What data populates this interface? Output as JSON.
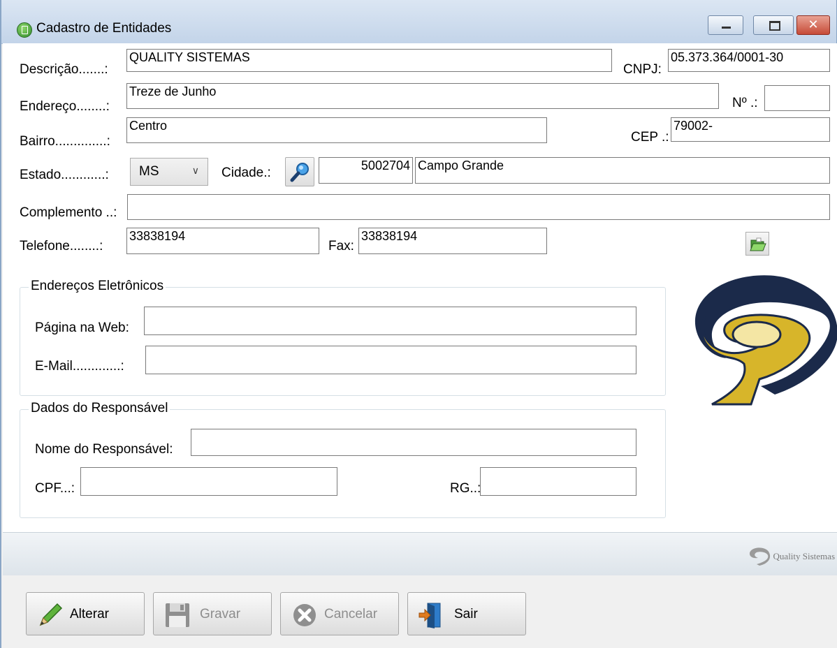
{
  "window": {
    "title": "Cadastro de Entidades",
    "close_glyph": "✕"
  },
  "form": {
    "descricao_label": "Descrição.......:",
    "descricao_value": "QUALITY SISTEMAS",
    "cnpj_label": "CNPJ:",
    "cnpj_value": "05.373.364/0001-30",
    "endereco_label": "Endereço........:",
    "endereco_value": "Treze de Junho",
    "numero_label": "Nº .:",
    "numero_value": "",
    "bairro_label": "Bairro..............:",
    "bairro_value": "Centro",
    "cep_label": "CEP .:",
    "cep_value": "79002-",
    "estado_label": "Estado............:",
    "estado_value": "MS",
    "cidade_label": "Cidade.:",
    "cidade_codigo": "5002704",
    "cidade_nome": "Campo Grande",
    "complemento_label": "Complemento ..:",
    "complemento_value": "",
    "telefone_label": "Telefone........:",
    "telefone_value": "33838194",
    "fax_label": "Fax:",
    "fax_value": "33838194"
  },
  "enderecos_eletronicos": {
    "title": "Endereços Eletrônicos",
    "web_label": "Página na Web:",
    "web_value": "",
    "email_label": "E-Mail.............:",
    "email_value": ""
  },
  "responsavel": {
    "title": "Dados do Responsável",
    "nome_label": "Nome do Responsável:",
    "nome_value": "",
    "cpf_label": "CPF...:",
    "cpf_value": "",
    "rg_label": "RG..:",
    "rg_value": ""
  },
  "status_bar": {
    "brand": "Quality Sistemas"
  },
  "toolbar": {
    "alterar": "Alterar",
    "gravar": "Gravar",
    "cancelar": "Cancelar",
    "sair": "Sair"
  },
  "icons": {
    "app": "app-icon",
    "search": "magnifier-icon",
    "folder": "folder-open-icon",
    "logo": "quality-sistemas-logo",
    "alterar": "pencil-icon",
    "gravar": "floppy-disk-icon",
    "cancelar": "cancel-icon",
    "sair": "exit-door-icon"
  },
  "colors": {
    "titlebar": "#c3d4e9",
    "close_button": "#c64a36",
    "input_border": "#7a7a7a",
    "logo_navy": "#1b2a4a",
    "logo_gold": "#d7b52a"
  }
}
